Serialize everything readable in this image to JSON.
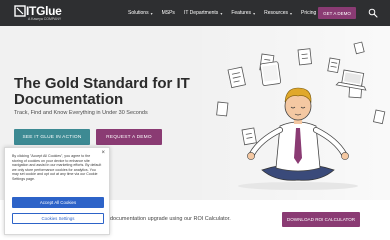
{
  "brand": {
    "name": "ITGlue",
    "sub": "A Kaseya COMPANY"
  },
  "nav": {
    "items": [
      {
        "label": "Solutions",
        "dropdown": true
      },
      {
        "label": "MSPs",
        "dropdown": false
      },
      {
        "label": "IT Departments",
        "dropdown": true
      },
      {
        "label": "Features",
        "dropdown": true
      },
      {
        "label": "Resources",
        "dropdown": true
      },
      {
        "label": "Pricing",
        "dropdown": false
      }
    ],
    "cta": "GET A DEMO",
    "search_icon": "search-icon"
  },
  "hero": {
    "headline": "The Gold Standard for IT Documentation",
    "tagline": "Track, Find and Know Everything in Under 30 Seconds",
    "buttons": {
      "see": "SEE IT GLUE IN ACTION",
      "demo": "REQUEST A DEMO"
    }
  },
  "strip": {
    "text": "documentation upgrade using our ROI Calculator.",
    "button": "DOWNLOAD ROI CALCULATOR"
  },
  "cookie": {
    "text": "By clicking \"Accept All Cookies\", you agree to the storing of cookies on your device to enhance site navigation and assist in our marketing efforts. By default we only store performance cookies for analytics. You may set cookie and opt out at any time via our Cookie Settings page.",
    "accept": "Accept All Cookies",
    "settings": "Cookies Settings",
    "close": "×"
  },
  "colors": {
    "nav_bg": "#2e2f31",
    "accent_purple": "#8a3b73",
    "accent_teal": "#3d8a93",
    "cookie_blue": "#2d63c8"
  }
}
